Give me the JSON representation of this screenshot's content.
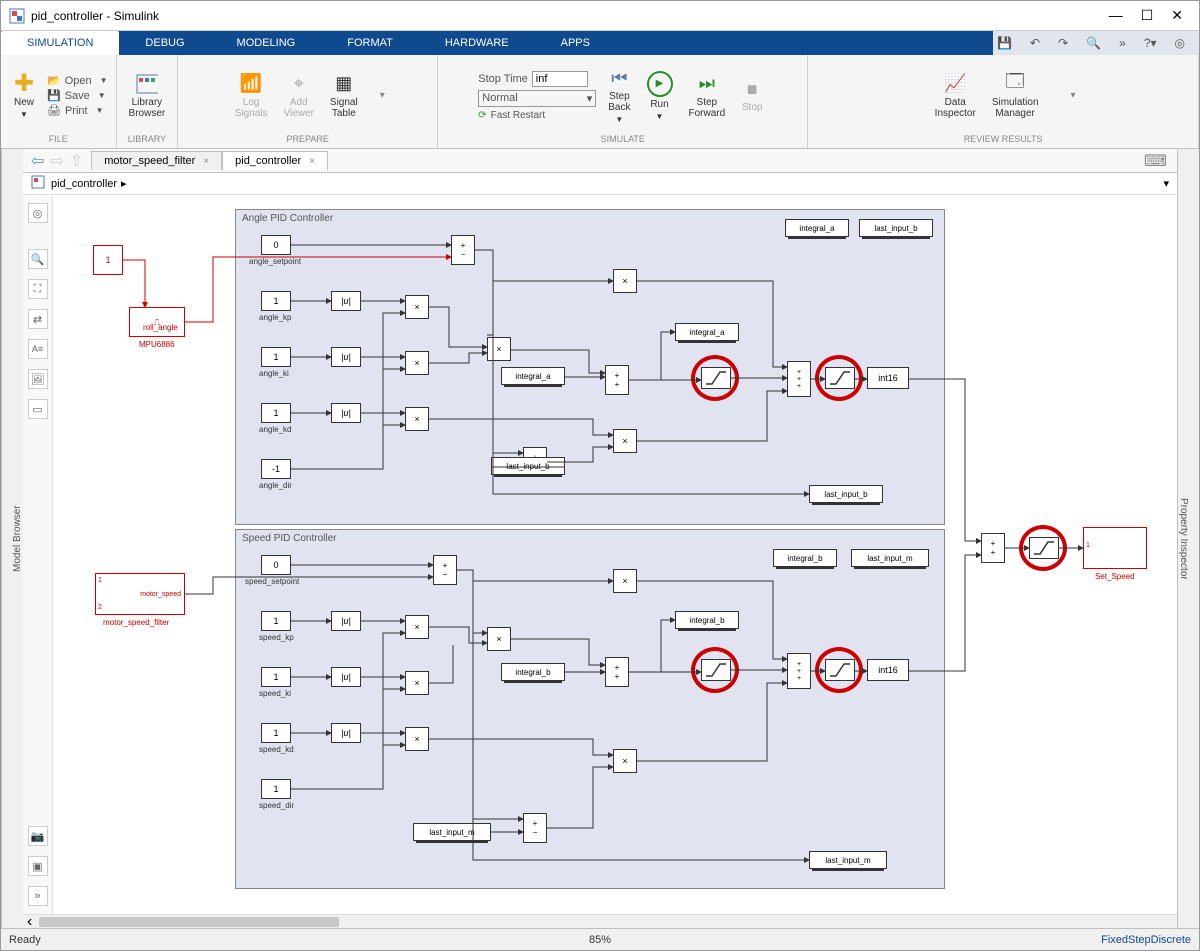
{
  "window": {
    "title": "pid_controller - Simulink"
  },
  "menu_tabs": [
    "SIMULATION",
    "DEBUG",
    "MODELING",
    "FORMAT",
    "HARDWARE",
    "APPS"
  ],
  "active_menu_tab": 0,
  "toolbar": {
    "file": {
      "new": "New",
      "open": "Open",
      "save": "Save",
      "print": "Print",
      "group": "FILE"
    },
    "library": {
      "label": "Library\nBrowser",
      "group": "LIBRARY"
    },
    "prepare": {
      "log": "Log\nSignals",
      "add": "Add\nViewer",
      "sigtable": "Signal\nTable",
      "group": "PREPARE"
    },
    "simulate": {
      "stoptime_label": "Stop Time",
      "stoptime_value": "inf",
      "mode": "Normal",
      "fastrestart": "Fast Restart",
      "stepback": "Step\nBack",
      "run": "Run",
      "stepfwd": "Step\nForward",
      "stop": "Stop",
      "group": "SIMULATE"
    },
    "review": {
      "datainsp": "Data\nInspector",
      "simmgr": "Simulation\nManager",
      "group": "REVIEW RESULTS"
    }
  },
  "tabs": [
    {
      "label": "motor_speed_filter",
      "active": false
    },
    {
      "label": "pid_controller",
      "active": true
    }
  ],
  "breadcrumb": "pid_controller",
  "left_panel_label": "Model Browser",
  "right_panel_label": "Property Inspector",
  "subsystems": {
    "angle": {
      "title": "Angle PID Controller",
      "rows": [
        {
          "val": "0",
          "label": "angle_setpoint"
        },
        {
          "val": "1",
          "label": "angle_kp",
          "abs": true
        },
        {
          "val": "1",
          "label": "angle_ki",
          "abs": true
        },
        {
          "val": "1",
          "label": "angle_kd",
          "abs": true
        },
        {
          "val": "-1",
          "label": "angle_dir"
        }
      ],
      "memstores": [
        "integral_a",
        "last_input_b"
      ],
      "read1": "integral_a",
      "write1": "integral_a",
      "write2": "last_input_b",
      "read2": "last_input_b",
      "dtype": "int16"
    },
    "speed": {
      "title": "Speed PID Controller",
      "rows": [
        {
          "val": "0",
          "label": "speed_setpoint"
        },
        {
          "val": "1",
          "label": "speed_kp",
          "abs": true
        },
        {
          "val": "1",
          "label": "speed_ki",
          "abs": true
        },
        {
          "val": "1",
          "label": "speed_kd",
          "abs": true
        },
        {
          "val": "1",
          "label": "speed_dir"
        }
      ],
      "memstores": [
        "integral_b",
        "last_input_m"
      ],
      "read1": "integral_b",
      "write1": "integral_b",
      "write2": "last_input_m",
      "read2": "last_input_m",
      "dtype": "int16"
    }
  },
  "inputs": {
    "mpu": "MPU6886",
    "roll": "roll_angle",
    "msf": "motor_speed_filter",
    "ms": "motor_speed"
  },
  "output": {
    "label": "Set_Speed"
  },
  "status": {
    "ready": "Ready",
    "zoom": "85%",
    "step": "FixedStepDiscrete"
  }
}
